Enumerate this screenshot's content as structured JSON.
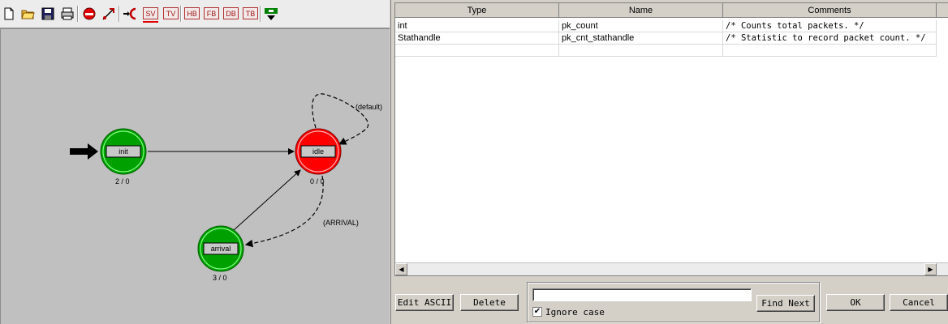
{
  "toolbar": {
    "text_buttons": [
      "SV",
      "TV",
      "HB",
      "FB",
      "DB",
      "TB"
    ]
  },
  "fsm": {
    "states": [
      {
        "name": "init",
        "counts": "2 / 0",
        "color": "#00a000"
      },
      {
        "name": "idle",
        "counts": "0 / 0",
        "color": "#ff0000"
      },
      {
        "name": "arrival",
        "counts": "3 / 0",
        "color": "#00a000"
      }
    ],
    "transitions": {
      "self_loop": "(default)",
      "idle_to_arrival": "(ARRIVAL)"
    }
  },
  "table": {
    "headers": [
      "Type",
      "Name",
      "Comments"
    ],
    "rows": [
      {
        "type": "int",
        "name": "pk_count",
        "comment": "/* Counts total packets. */"
      },
      {
        "type": "Stathandle",
        "name": "pk_cnt_stathandle",
        "comment": "/* Statistic to record packet count. */"
      }
    ]
  },
  "buttons": {
    "edit_ascii": "Edit ASCII",
    "delete": "Delete",
    "find_next": "Find Next",
    "ok": "OK",
    "cancel": "Cancel"
  },
  "find": {
    "value": "",
    "ignore_case_label": "Ignore case",
    "ignore_case_checked": true
  }
}
